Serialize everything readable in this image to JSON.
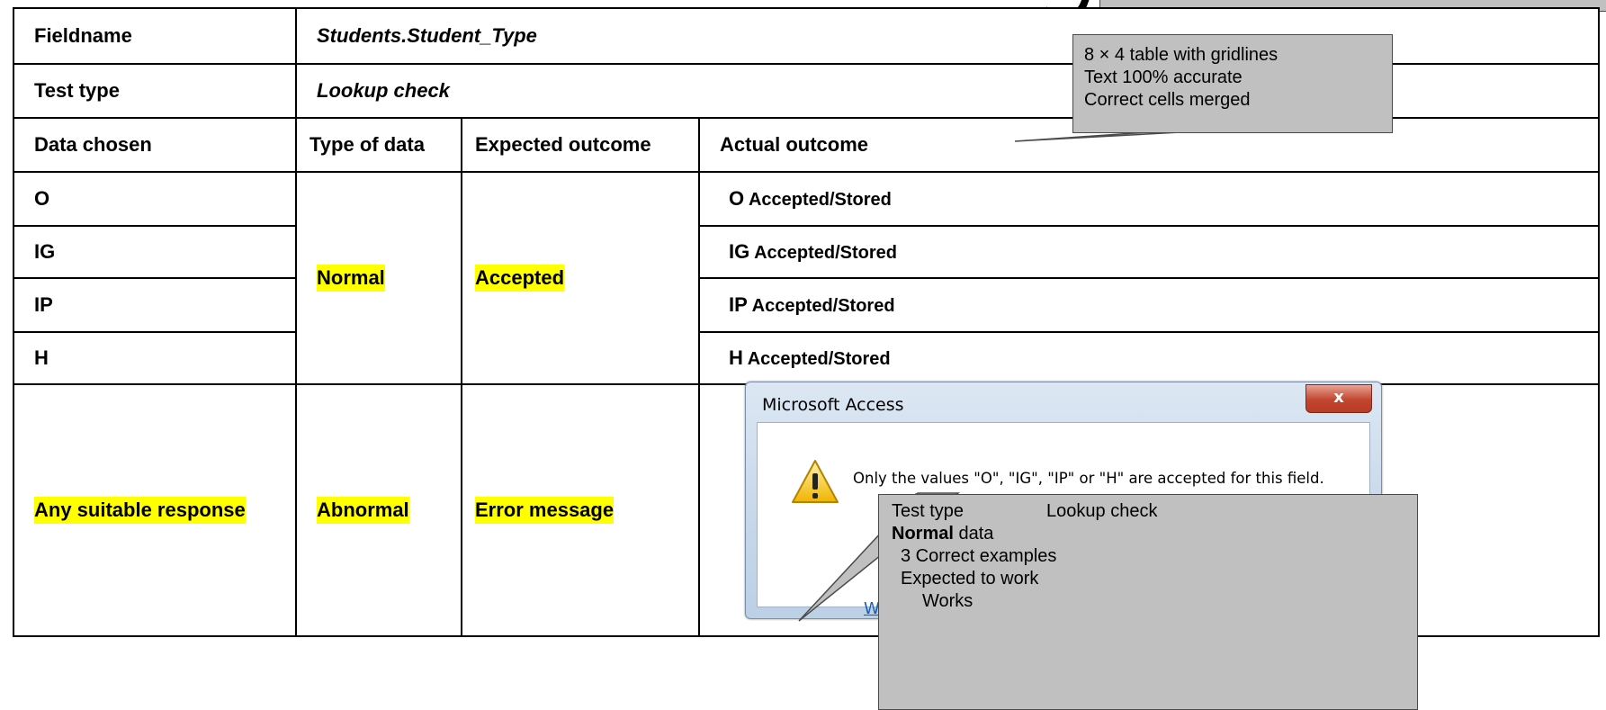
{
  "table": {
    "fieldname_label": "Fieldname",
    "fieldname_value": "Students.Student_Type",
    "testtype_label": "Test type",
    "testtype_value": "Lookup check",
    "headers": [
      "Data chosen",
      "Type of data",
      "Expected outcome",
      "Actual outcome"
    ],
    "rows": [
      {
        "data": "O",
        "actual_code": "O",
        "actual_text": "Accepted/Stored"
      },
      {
        "data": "IG",
        "actual_code": "IG",
        "actual_text": "Accepted/Stored"
      },
      {
        "data": "IP",
        "actual_code": "IP",
        "actual_text": "Accepted/Stored"
      },
      {
        "data": "H",
        "actual_code": "H",
        "actual_text": "Accepted/Stored"
      }
    ],
    "normal_type": "Normal",
    "normal_expected": "Accepted",
    "abnormal_data": "Any suitable response",
    "abnormal_type": "Abnormal",
    "abnormal_expected": "Error message"
  },
  "dialog": {
    "title": "Microsoft Access",
    "close": "x",
    "message": "Only the values \"O\", \"IG\", \"IP\" or \"H\" are accepted for this field.",
    "link": "Was"
  },
  "callout_top": {
    "line1": "8 × 4 table with gridlines",
    "line2": "Text 100% accurate",
    "line3": "Correct cells merged"
  },
  "callout_bottom": {
    "testtype_label": "Test type",
    "testtype_value": "Lookup check",
    "normal_bold": "Normal",
    "normal_rest": " data",
    "item1": "3 Correct examples",
    "item2": "Expected to work",
    "item3": "Works"
  },
  "colors": {
    "highlight": "#ffff00",
    "callout": "#c0c0c0"
  }
}
